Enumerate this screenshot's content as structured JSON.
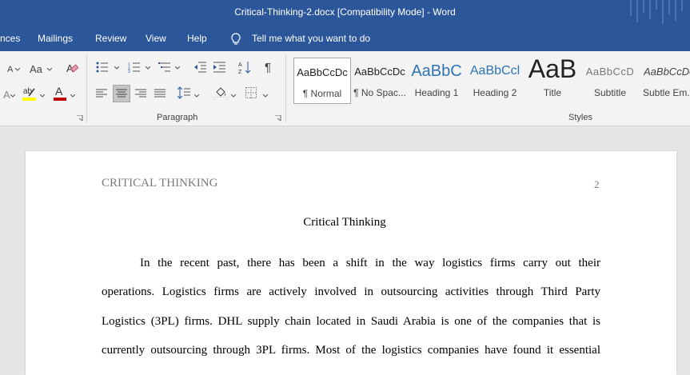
{
  "window": {
    "title": "Critical-Thinking-2.docx [Compatibility Mode]  -  Word"
  },
  "menu": {
    "tabs": [
      "nces",
      "Mailings",
      "Review",
      "View",
      "Help"
    ],
    "tell_me": "Tell me what you want to do"
  },
  "ribbon": {
    "font_aa": "Aa",
    "a_small": "A",
    "paragraph_label": "Paragraph",
    "styles_label": "Styles",
    "styles": [
      {
        "preview": "AaBbCcDc",
        "name": "¶ Normal"
      },
      {
        "preview": "AaBbCcDc",
        "name": "¶ No Spac..."
      },
      {
        "preview": "AaBbC",
        "name": "Heading 1"
      },
      {
        "preview": "AaBbCcl",
        "name": "Heading 2"
      },
      {
        "preview": "AaB",
        "name": "Title"
      },
      {
        "preview": "AaBbCcD",
        "name": "Subtitle"
      },
      {
        "preview": "AaBbCcDc",
        "name": "Subtle Em..."
      }
    ],
    "colors": {
      "highlight": "#ffff00",
      "font_color": "#c00000",
      "accent": "#2b579a"
    }
  },
  "document": {
    "header_left": "CRITICAL THINKING",
    "page_number": "2",
    "title": "Critical Thinking",
    "lines": [
      "In the recent past, there has been a shift in the way logistics firms carry out their",
      "operations. Logistics firms are actively involved in outsourcing activities through Third Party",
      "Logistics (3PL) firms. DHL supply chain located in Saudi Arabia is one of the companies that is",
      "currently outsourcing through 3PL firms. Most of the logistics companies have found it essential"
    ]
  }
}
